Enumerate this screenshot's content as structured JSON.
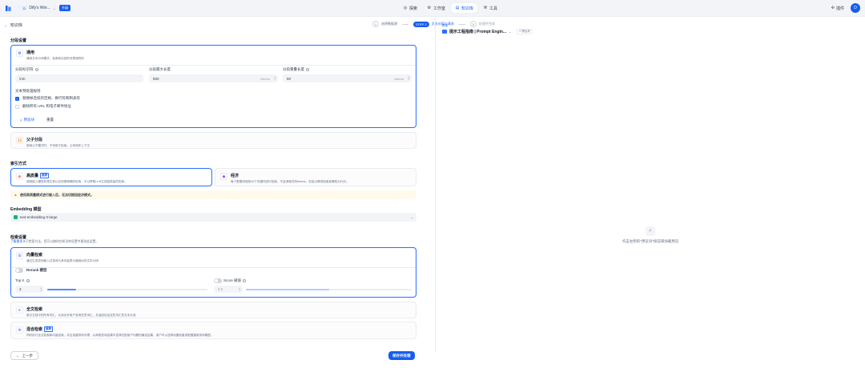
{
  "topbar": {
    "workspace": "Dify's Wor...",
    "workspace_initial": "D",
    "upgrade": "升级",
    "nav": [
      {
        "label": "探索",
        "icon": "compass-icon"
      },
      {
        "label": "工作室",
        "icon": "studio-icon"
      },
      {
        "label": "知识库",
        "icon": "database-icon",
        "active": true
      },
      {
        "label": "工具",
        "icon": "tools-icon"
      }
    ],
    "plugin": "插件",
    "avatar_initial": "D"
  },
  "header": {
    "back_label": "知识库",
    "steps": [
      {
        "num": "1",
        "label": "选择数据源"
      },
      {
        "pill": "STEP 2",
        "label": "文本分段与清洗"
      },
      {
        "num": "3",
        "label": "处理并完成"
      }
    ]
  },
  "segment": {
    "title": "分段设置",
    "general": {
      "title": "通用",
      "desc": "通用文本分块模式，检索和召回的块是相同的",
      "separator_label": "分段标识符",
      "separator_value": "\\n\\n",
      "max_len_label": "分段最大长度",
      "max_len_value": "500",
      "overlap_label": "分段重叠长度",
      "overlap_value": "50",
      "unit": "tokens",
      "rules_label": "文本预处理规则",
      "rule1": "替换掉连续的空格、换行符和制表符",
      "rule2": "删除所有 URL 和电子邮件地址",
      "preview_btn": "预览块",
      "reset_btn": "重置"
    },
    "parent_child": {
      "title": "父子分段",
      "desc": "使用父子模式时，子块用于检索，父块用作上下文"
    }
  },
  "index": {
    "title": "索引方式",
    "high": {
      "title": "高质量",
      "badge": "推荐",
      "desc": "调用嵌入模型处理文档以实现更精确的检索，可以帮助LLM生成高质量的答案。"
    },
    "economy": {
      "title": "经济",
      "desc": "每个数据块使用10个关键词进行检索，不会消耗任何tokens，但会以降低检索准确性为代价。"
    },
    "warning": "使用高质量模式进行嵌入后，无法切换回经济模式。"
  },
  "embedding": {
    "title": "Embedding 模型",
    "model": "text-embedding-3-large"
  },
  "retrieval": {
    "title": "检索设置",
    "subtitle_link": "了解更多",
    "subtitle": "关于检索方法，您可以随时在知识库设置中更改此设置。",
    "vector": {
      "title": "向量检索",
      "desc": "通过生成查询嵌入并查询与其向量表示最相似的文本分段",
      "rerank_label": "Rerank 模型",
      "topk_label": "Top K",
      "topk_value": "3",
      "topk_fill": 0.18,
      "score_label": "Score 阈值",
      "score_value": "0.5",
      "score_fill": 0.5
    },
    "fulltext": {
      "title": "全文检索",
      "desc": "索引文档中的所有词汇，从而允许用户查询任意词汇，并返回包含这些词汇的文本片段"
    },
    "hybrid": {
      "title": "混合检索",
      "badge": "推荐",
      "desc": "同时执行全文检索和向量检索，并应用重排序步骤，从两类查询结果中选择匹配用户问题的最佳结果，用户可以选择设置权重或配置重新排序模型。"
    }
  },
  "footer": {
    "back": "上一步",
    "save": "保存并处理"
  },
  "preview": {
    "label": "预览",
    "doc_title": "提示工程指南 | Prompt Engin...",
    "tag": "0 预估块",
    "empty": "点击左侧的\"预览块\"按钮来加载预览"
  }
}
